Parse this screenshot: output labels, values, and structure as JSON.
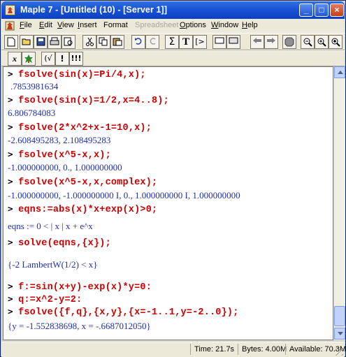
{
  "window": {
    "title": "Maple 7 - [Untitled (10) - [Server 1]]"
  },
  "titlebar": {
    "minimize": "_",
    "maximize": "□",
    "close": "×"
  },
  "menu": [
    {
      "label": "File",
      "u": "F",
      "rest": "ile",
      "disabled": false
    },
    {
      "label": "Edit",
      "u": "E",
      "rest": "dit",
      "disabled": false
    },
    {
      "label": "View",
      "u": "V",
      "rest": "iew",
      "disabled": false
    },
    {
      "label": "Insert",
      "u": "I",
      "rest": "nsert",
      "disabled": false
    },
    {
      "label": "Format",
      "u": "",
      "rest": "Format",
      "disabled": false
    },
    {
      "label": "Spreadsheet",
      "u": "",
      "rest": "Spreadsheet",
      "disabled": true
    },
    {
      "label": "Options",
      "u": "O",
      "rest": "ptions",
      "disabled": false
    },
    {
      "label": "Window",
      "u": "W",
      "rest": "indow",
      "disabled": false
    },
    {
      "label": "Help",
      "u": "H",
      "rest": "elp",
      "disabled": false
    }
  ],
  "toolbar2": {
    "x_label": "x",
    "exec_label": "!",
    "exec_all_label": "!!!"
  },
  "worksheet": {
    "rows": [
      {
        "kind": "cmd",
        "text": "fsolve(sin(x)=Pi/4,x);"
      },
      {
        "kind": "out",
        "text": ".7853981634"
      },
      {
        "kind": "cmd",
        "text": "fsolve(sin(x)=1/2,x=4..8);"
      },
      {
        "kind": "out",
        "text": "6.806784083"
      },
      {
        "kind": "cmd",
        "text": "fsolve(2*x^2+x-1=10,x);"
      },
      {
        "kind": "out",
        "text": "-2.608495283, 2.108495283"
      },
      {
        "kind": "cmd",
        "text": "fsolve(x^5-x,x);"
      },
      {
        "kind": "out",
        "text": "-1.000000000, 0., 1.000000000"
      },
      {
        "kind": "cmd",
        "text": "fsolve(x^5-x,x,complex);"
      },
      {
        "kind": "out",
        "text": "-1.000000000, -1.000000000 I, 0., 1.000000000 I, 1.000000000"
      },
      {
        "kind": "cmd",
        "text": "eqns:=abs(x)*x+exp(x)>0;"
      },
      {
        "kind": "out",
        "text": "eqns := 0 < | x | x + e^x"
      },
      {
        "kind": "cmd",
        "text": "solve(eqns,{x});"
      },
      {
        "kind": "out",
        "text": "{-2 LambertW(1/2) < x}"
      },
      {
        "kind": "cmd",
        "text": "f:=sin(x+y)-exp(x)*y=0:"
      },
      {
        "kind": "cmd",
        "text": "q:=x^2-y=2:"
      },
      {
        "kind": "cmd",
        "text": "fsolve({f,q},{x,y},{x=-1..1,y=-2..0});"
      },
      {
        "kind": "out",
        "text": "{y = -1.552838698, x = -.6687012050}"
      }
    ]
  },
  "statusbar": {
    "time": "Time: 21.7s",
    "bytes": "Bytes: 4.00M",
    "available": "Available: 70.3M"
  }
}
